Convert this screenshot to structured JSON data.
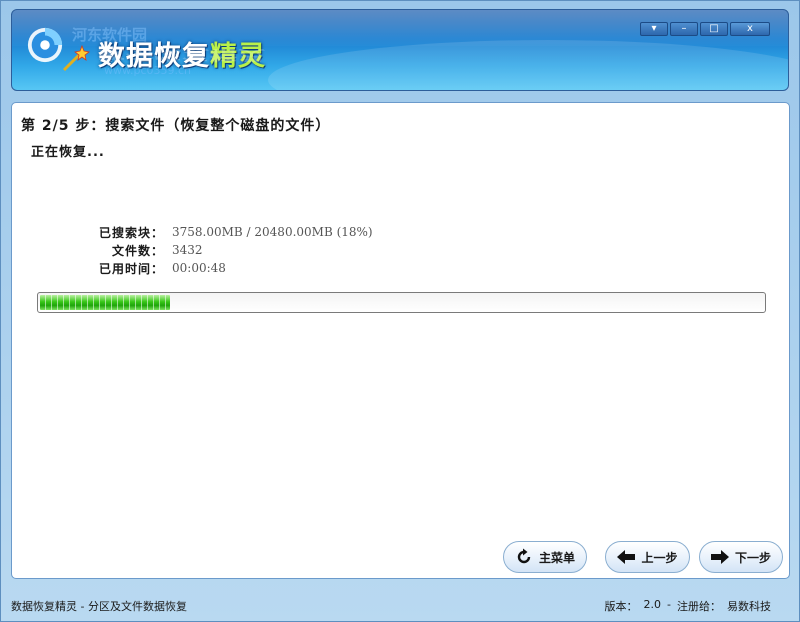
{
  "window": {
    "app_title_a": "数据恢复",
    "app_title_b": "精灵",
    "watermark_text": "河东软件园",
    "watermark_sub": "www.pc0359.cn",
    "controls": {
      "menu": "▾",
      "minimize": "–",
      "maximize": "□",
      "close": "x"
    }
  },
  "wizard": {
    "step_title": "第 2/5 步：搜索文件（恢复整个磁盘的文件）",
    "status": "正在恢复..."
  },
  "stats": [
    {
      "label": "已搜索块：",
      "value": "3758.00MB / 20480.00MB (18%)"
    },
    {
      "label": "文件数：",
      "value": "3432"
    },
    {
      "label": "已用时间：",
      "value": "00:00:48"
    }
  ],
  "progress": {
    "percent": 18
  },
  "buttons": {
    "main_menu": "主菜单",
    "prev": "上一步",
    "next": "下一步"
  },
  "statusbar": {
    "left": "数据恢复精灵 - 分区及文件数据恢复",
    "version_label": "版本：",
    "version": "2.0",
    "sep": "-",
    "reg_label": "注册给：",
    "reg_to": "易数科技"
  },
  "colors": {
    "banner": "#1b7ed0",
    "progress": "#2cb614",
    "accent_title": "#b9f04a"
  }
}
